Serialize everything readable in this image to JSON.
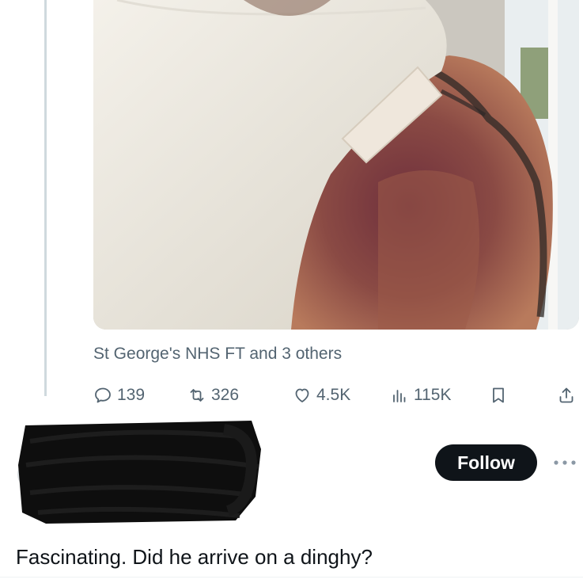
{
  "tweet": {
    "media_tags": "St George's NHS FT and 3 others",
    "actions": {
      "replies": "139",
      "reposts": "326",
      "likes": "4.5K",
      "views": "115K"
    }
  },
  "reply": {
    "follow_label": "Follow",
    "text": "Fascinating. Did he arrive on a dinghy?"
  },
  "colors": {
    "text_primary": "#0f1419",
    "text_secondary": "#536471",
    "follow_bg": "#0f1419",
    "thread_line": "#cfd9de"
  }
}
